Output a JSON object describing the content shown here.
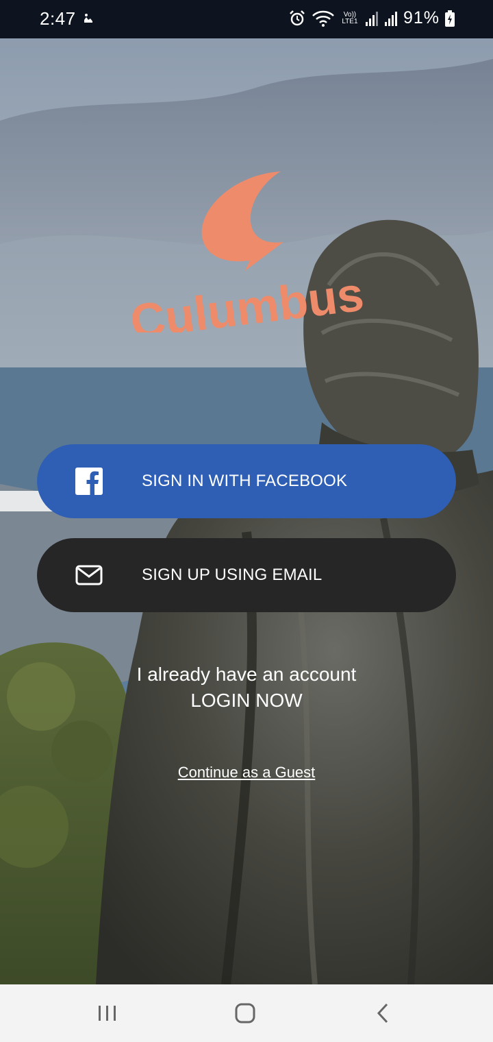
{
  "status_bar": {
    "time": "2:47",
    "battery": "91%",
    "icons": [
      "notification-icon",
      "alarm-icon",
      "wifi-icon",
      "volte-lte-icon",
      "signal-icon",
      "signal-icon",
      "battery-charging-icon"
    ],
    "network_label": "Vo)) LTE1"
  },
  "app": {
    "logo_text": "Culumbus",
    "logo_color": "#ee8b6a"
  },
  "buttons": {
    "facebook_label": "SIGN IN WITH FACEBOOK",
    "facebook_color": "#2f5fb4",
    "email_label": "SIGN UP USING EMAIL",
    "email_color": "#262626"
  },
  "account": {
    "prompt": "I already have an account",
    "login_label": "LOGIN NOW"
  },
  "guest": {
    "label": "Continue as a Guest"
  },
  "nav_bar": {
    "icons": [
      "recent-apps-icon",
      "home-icon",
      "back-icon"
    ]
  }
}
